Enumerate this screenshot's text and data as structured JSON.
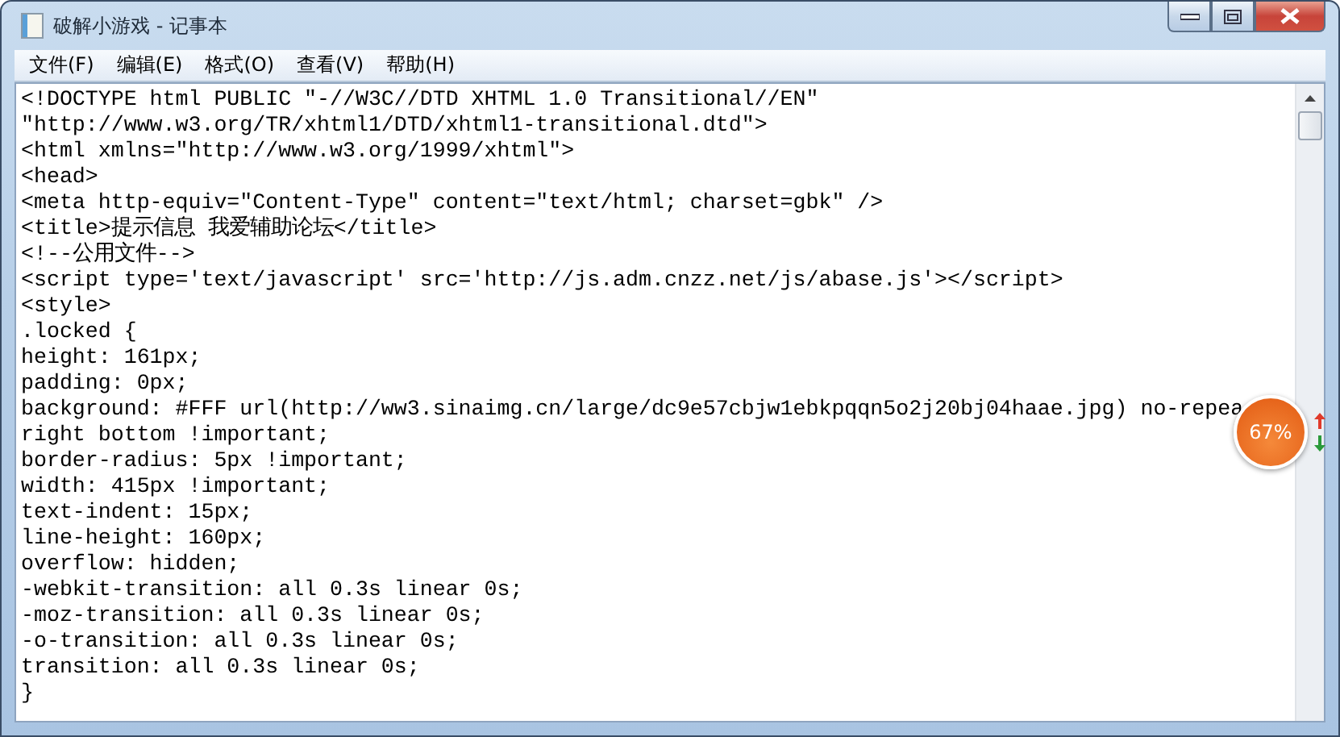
{
  "window": {
    "title": "破解小游戏 - 记事本"
  },
  "menu": [
    "文件(F)",
    "编辑(E)",
    "格式(O)",
    "查看(V)",
    "帮助(H)"
  ],
  "editor": {
    "lines": [
      "<!DOCTYPE html PUBLIC \"-//W3C//DTD XHTML 1.0 Transitional//EN\"",
      "\"http://www.w3.org/TR/xhtml1/DTD/xhtml1-transitional.dtd\">",
      "<html xmlns=\"http://www.w3.org/1999/xhtml\">",
      "<head>",
      "<meta http-equiv=\"Content-Type\" content=\"text/html; charset=gbk\" />",
      "<title>提示信息 我爱辅助论坛</title>",
      "<!--公用文件-->",
      "<script type='text/javascript' src='http://js.adm.cnzz.net/js/abase.js'></script>",
      "<style>",
      ".locked {",
      "height: 161px;",
      "padding: 0px;",
      "background: #FFF url(http://ww3.sinaimg.cn/large/dc9e57cbjw1ebkpqqn5o2j20bj04haae.jpg) no-repea",
      "right bottom !important;",
      "border-radius: 5px !important;",
      "width: 415px !important;",
      "text-indent: 15px;",
      "line-height: 160px;",
      "overflow: hidden;",
      "-webkit-transition: all 0.3s linear 0s;",
      "-moz-transition: all 0.3s linear 0s;",
      "-o-transition: all 0.3s linear 0s;",
      "transition: all 0.3s linear 0s;",
      "}"
    ]
  },
  "speed_ball": {
    "label": "67%"
  }
}
